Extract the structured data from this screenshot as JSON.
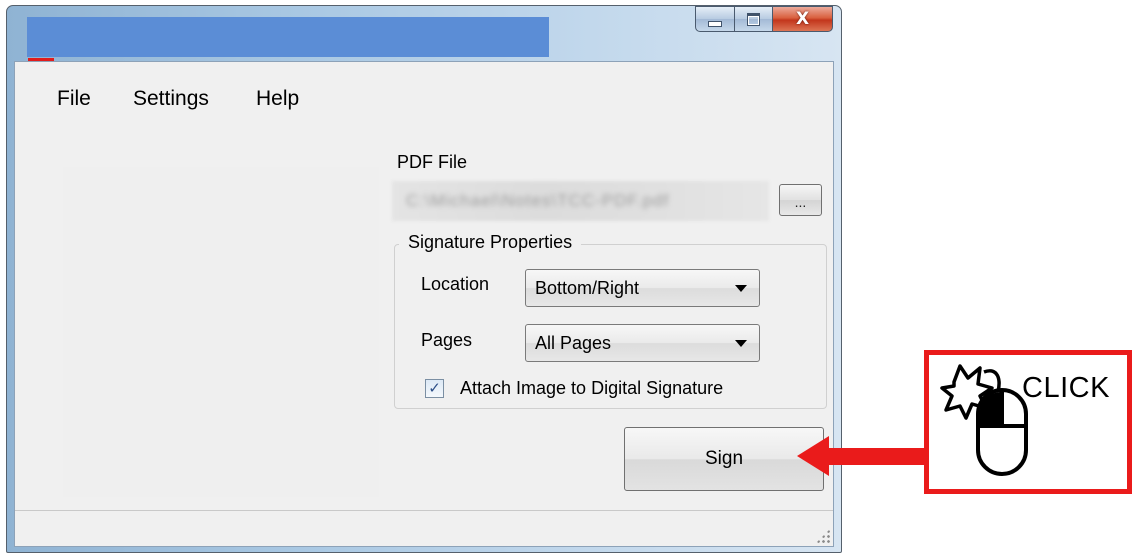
{
  "window": {
    "menu": [
      "File",
      "Settings",
      "Help"
    ],
    "caption_buttons": [
      "minimize-icon",
      "maximize-icon",
      "close-icon"
    ],
    "close_glyph": "X"
  },
  "pdf": {
    "label": "PDF File",
    "value": "C:\\Michael\\Notes\\TCC-PDF.pdf",
    "browse_label": "..."
  },
  "signature_properties": {
    "title": "Signature Properties",
    "location_label": "Location",
    "location_value": "Bottom/Right",
    "pages_label": "Pages",
    "pages_value": "All Pages",
    "attach_label": "Attach Image to Digital Signature",
    "attach_checked": true
  },
  "sign_label": "Sign",
  "annotation": {
    "click_text": "CLICK",
    "color": "#ea1b1b"
  }
}
